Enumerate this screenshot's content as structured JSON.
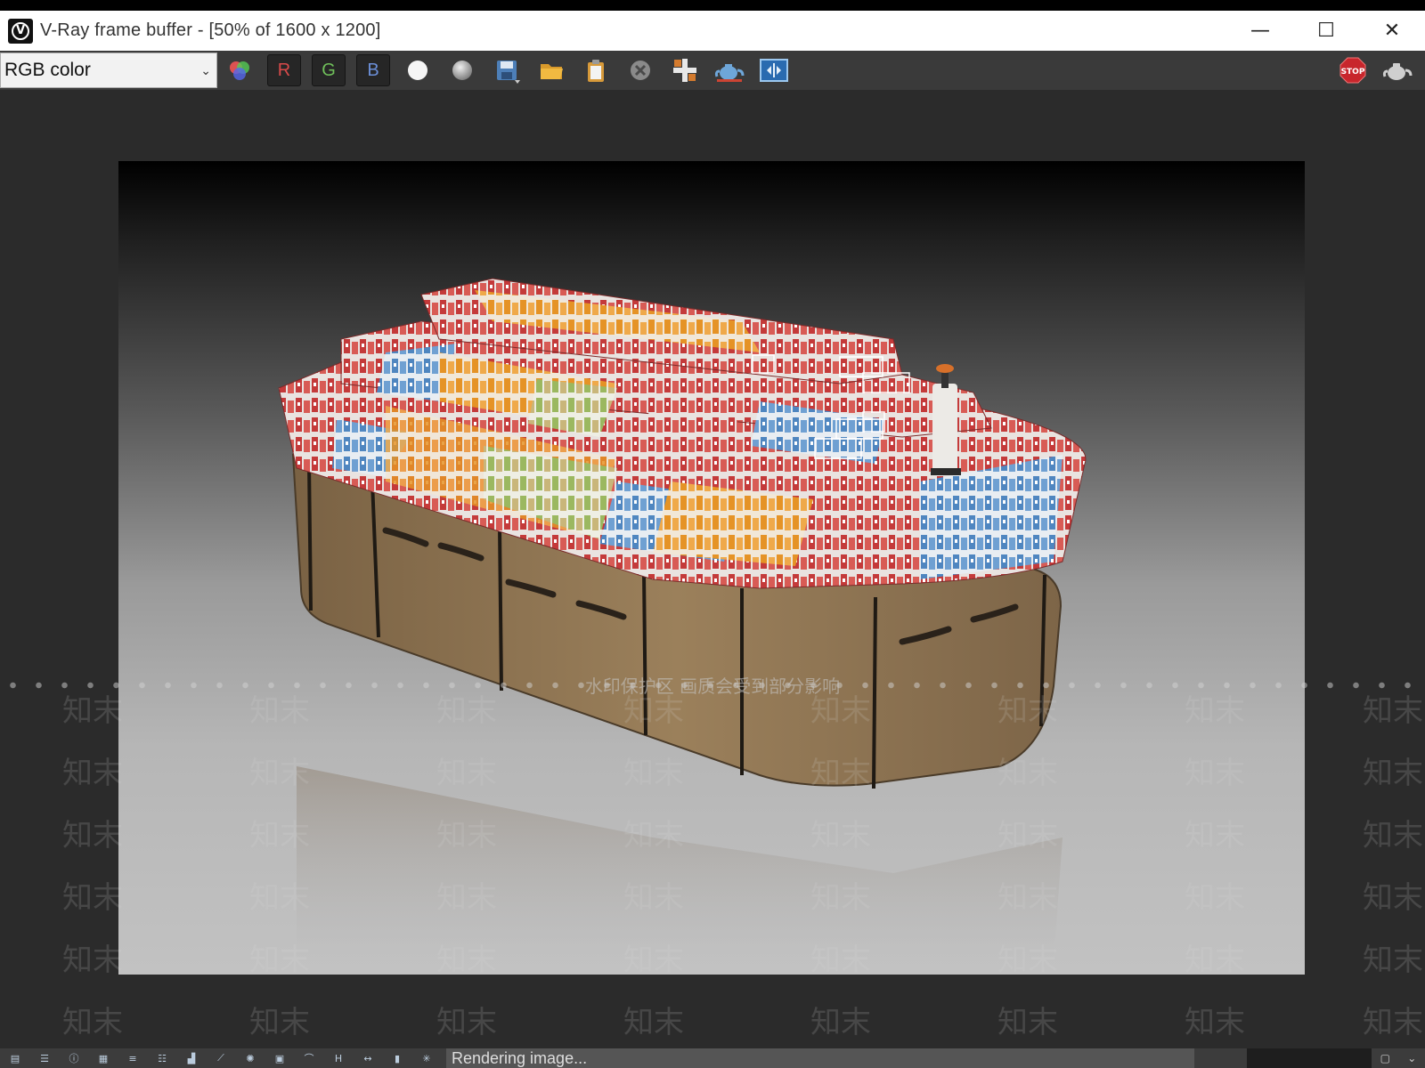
{
  "window": {
    "title": "V-Ray frame buffer - [50% of 1600 x 1200]",
    "controls": {
      "minimize": "—",
      "maximize": "☐",
      "close": "✕"
    }
  },
  "toolbar": {
    "channel_select": {
      "value": "RGB color"
    },
    "channel_buttons": {
      "r": "R",
      "g": "G",
      "b": "B"
    },
    "icons": [
      "color-wheel-icon",
      "white-circle-icon",
      "grey-circle-icon",
      "save-icon",
      "open-folder-icon",
      "clipboard-icon",
      "clear-icon",
      "track-mouse-icon",
      "teapot-render-icon",
      "compare-ab-icon",
      "stop-icon",
      "teapot-icon"
    ],
    "stop_label": "STOP"
  },
  "viewport": {
    "watermark_caption": "水印保护区 画质会受到部分影响",
    "watermark_text": "知末"
  },
  "statusbar": {
    "status_text": "Rendering image...",
    "icons": [
      "layers-icon",
      "history-icon",
      "info-icon",
      "color-correction-icon",
      "hsl-icon",
      "levels-icon",
      "histogram-icon",
      "curves-icon",
      "exposure-icon",
      "white-balance-icon",
      "lut-icon",
      "h-icon",
      "ocio-icon",
      "stereo-icon",
      "lens-effects-icon"
    ]
  },
  "colors": {
    "accent_stop": "#c8262c",
    "channel_r": "#d94a4a",
    "channel_g": "#6fbf5a",
    "channel_b": "#6b8fd8"
  }
}
